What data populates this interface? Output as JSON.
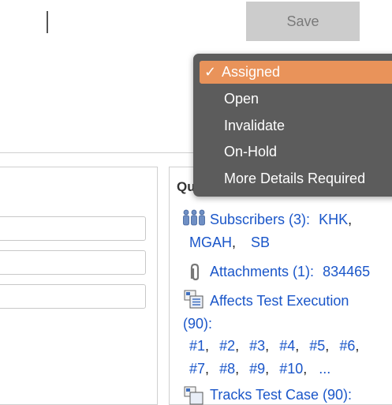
{
  "toolbar": {
    "save_label": "Save"
  },
  "status_dropdown": {
    "selected_mark": "✓",
    "options": [
      "Assigned",
      "Open",
      "Invalidate",
      "On-Hold",
      "More Details Required"
    ]
  },
  "quick_panel": {
    "header_partial": "Qu",
    "subscribers": {
      "label": "Subscribers (3):",
      "items": [
        "KHK",
        "MGAH",
        "SB"
      ]
    },
    "attachments": {
      "label": "Attachments (1):",
      "value": "834465"
    },
    "affects": {
      "label_line1": "Affects Test Execution",
      "label_line2": "(90):",
      "items": [
        "#1",
        "#2",
        "#3",
        "#4",
        "#5",
        "#6",
        "#7",
        "#8",
        "#9",
        "#10"
      ],
      "more": "..."
    },
    "next_partial": "Tracks Test Case (90):"
  },
  "colors": {
    "link": "#1a56c9",
    "dropdown_bg": "#5c5c5c",
    "selected_bg": "#e9935a",
    "button_bg": "#cccccc"
  }
}
